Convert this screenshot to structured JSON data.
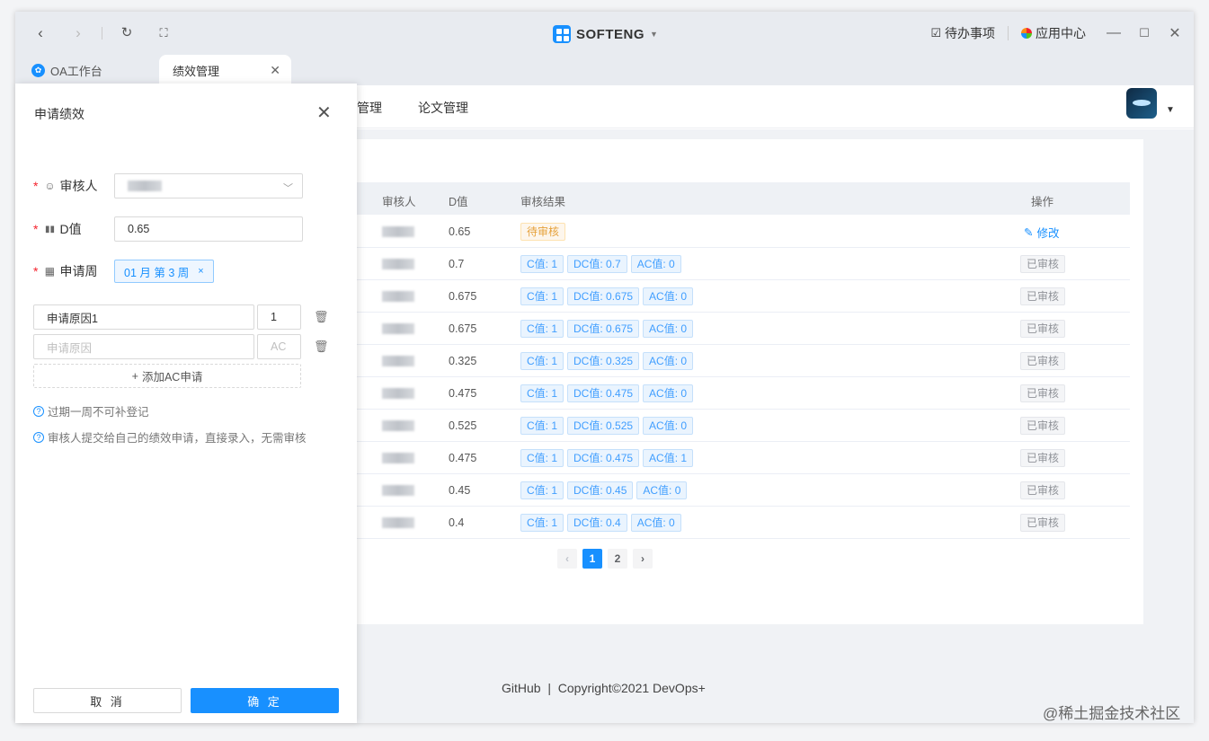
{
  "titlebar": {
    "brand": "SOFTENG",
    "todo": "待办事项",
    "app_center": "应用中心"
  },
  "tabs": [
    {
      "label": "OA工作台"
    },
    {
      "label": "绩效管理"
    }
  ],
  "appnav": {
    "menu": [
      "管理",
      "论文管理"
    ]
  },
  "table": {
    "headers": [
      "审核人",
      "D值",
      "审核结果",
      "操作"
    ],
    "rows": [
      {
        "d": "0.65",
        "pending": "待审核",
        "action": "修改"
      },
      {
        "d": "0.7",
        "c": "C值: 1",
        "dc": "DC值: 0.7",
        "ac": "AC值: 0",
        "status": "已审核"
      },
      {
        "d": "0.675",
        "c": "C值: 1",
        "dc": "DC值: 0.675",
        "ac": "AC值: 0",
        "status": "已审核"
      },
      {
        "d": "0.675",
        "c": "C值: 1",
        "dc": "DC值: 0.675",
        "ac": "AC值: 0",
        "status": "已审核"
      },
      {
        "d": "0.325",
        "c": "C值: 1",
        "dc": "DC值: 0.325",
        "ac": "AC值: 0",
        "status": "已审核"
      },
      {
        "d": "0.475",
        "c": "C值: 1",
        "dc": "DC值: 0.475",
        "ac": "AC值: 0",
        "status": "已审核"
      },
      {
        "d": "0.525",
        "c": "C值: 1",
        "dc": "DC值: 0.525",
        "ac": "AC值: 0",
        "status": "已审核"
      },
      {
        "d": "0.475",
        "c": "C值: 1",
        "dc": "DC值: 0.475",
        "ac": "AC值: 1",
        "status": "已审核"
      },
      {
        "d": "0.45",
        "c": "C值: 1",
        "dc": "DC值: 0.45",
        "ac": "AC值: 0",
        "status": "已审核"
      },
      {
        "d": "0.4",
        "c": "C值: 1",
        "dc": "DC值: 0.4",
        "ac": "AC值: 0",
        "status": "已审核"
      }
    ]
  },
  "pagination": {
    "prev": "‹",
    "pages": [
      "1",
      "2"
    ],
    "next": "›",
    "current": "1"
  },
  "footer": "GitHub  |  Copyright©2021 DevOps+",
  "drawer": {
    "title": "申请绩效",
    "reviewer_label": "审核人",
    "d_label": "D值",
    "d_value": "0.65",
    "week_label": "申请周",
    "week_value": "01 月 第 3 周",
    "reason1_value": "申请原因1",
    "reason1_ac": "1",
    "reason_placeholder": "申请原因",
    "ac_placeholder": "AC",
    "add_ac": "添加AC申请",
    "hint1": "过期一周不可补登记",
    "hint2": "审核人提交给自己的绩效申请，直接录入，无需审核",
    "cancel": "取 消",
    "confirm": "确 定"
  },
  "watermark": "@稀土掘金技术社区"
}
